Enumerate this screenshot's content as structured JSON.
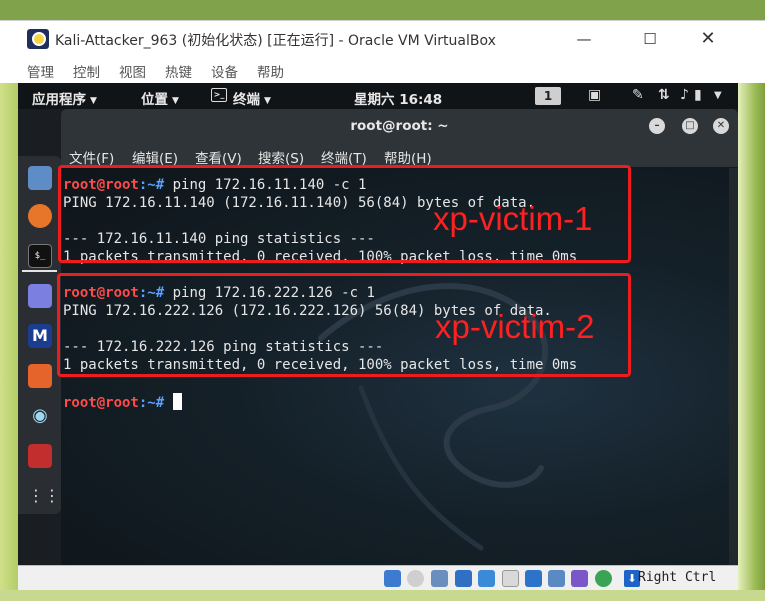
{
  "window": {
    "title": "Kali-Attacker_963 (初始化状态) [正在运行] - Oracle VM VirtualBox",
    "minimize": "—",
    "maximize": "☐",
    "close": "✕"
  },
  "vbox_menu": [
    "管理",
    "控制",
    "视图",
    "热键",
    "设备",
    "帮助"
  ],
  "gnome_bar": {
    "applications": "应用程序",
    "places": "位置",
    "terminal_menu": "终端",
    "clock": "星期六 16:48",
    "workspace": "1"
  },
  "terminal": {
    "title": "root@root: ~",
    "menu": [
      "文件(F)",
      "编辑(E)",
      "查看(V)",
      "搜索(S)",
      "终端(T)",
      "帮助(H)"
    ],
    "prompt_user": "root@root",
    "prompt_path": ":~#",
    "lines": [
      {
        "type": "cmd",
        "text": " ping 172.16.11.140 -c 1"
      },
      {
        "type": "out",
        "text": "PING 172.16.11.140 (172.16.11.140) 56(84) bytes of data."
      },
      {
        "type": "out",
        "text": ""
      },
      {
        "type": "out",
        "text": "--- 172.16.11.140 ping statistics ---"
      },
      {
        "type": "out",
        "text": "1 packets transmitted, 0 received, 100% packet loss, time 0ms"
      },
      {
        "type": "out",
        "text": ""
      },
      {
        "type": "cmd",
        "text": " ping 172.16.222.126 -c 1"
      },
      {
        "type": "out",
        "text": "PING 172.16.222.126 (172.16.222.126) 56(84) bytes of data."
      },
      {
        "type": "out",
        "text": ""
      },
      {
        "type": "out",
        "text": "--- 172.16.222.126 ping statistics ---"
      },
      {
        "type": "out",
        "text": "1 packets transmitted, 0 received, 100% packet loss, time 0ms"
      },
      {
        "type": "out",
        "text": ""
      },
      {
        "type": "cmd",
        "text": " "
      }
    ]
  },
  "annotations": {
    "victim1": "xp-victim-1",
    "victim2": "xp-victim-2",
    "color": "#ee1c1c"
  },
  "statusbar": {
    "host_key": "Right Ctrl"
  }
}
